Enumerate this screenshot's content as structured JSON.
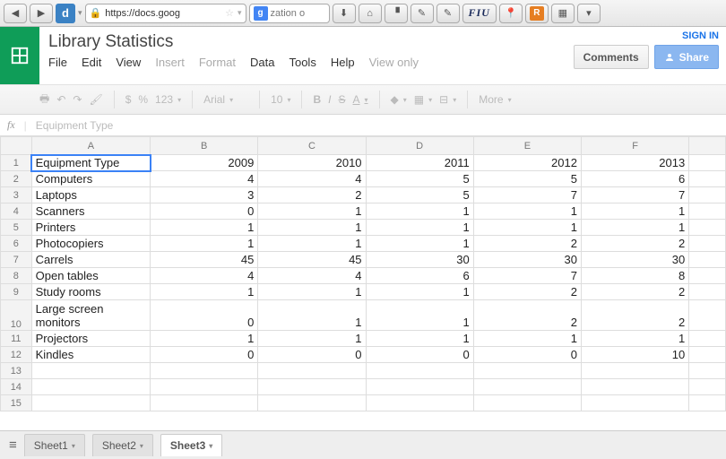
{
  "browser": {
    "url": "https://docs.goog",
    "search_text": "zation o"
  },
  "doc": {
    "title": "Library Statistics",
    "signin": "SIGN IN",
    "comments_label": "Comments",
    "share_label": "Share"
  },
  "menu": {
    "file": "File",
    "edit": "Edit",
    "view": "View",
    "insert": "Insert",
    "format": "Format",
    "data": "Data",
    "tools": "Tools",
    "help": "Help",
    "viewonly": "View only"
  },
  "toolbar": {
    "currency": "$",
    "percent": "%",
    "numfmt": "123",
    "font": "Arial",
    "size": "10",
    "bold": "B",
    "italic": "I",
    "strike": "S",
    "more": "More"
  },
  "fx": {
    "label": "fx",
    "value": "Equipment Type"
  },
  "columns": [
    "A",
    "B",
    "C",
    "D",
    "E",
    "F"
  ],
  "row_headers": [
    "1",
    "2",
    "3",
    "4",
    "5",
    "6",
    "7",
    "8",
    "9",
    "10",
    "11",
    "12",
    "13",
    "14",
    "15"
  ],
  "chart_data": {
    "type": "table",
    "title": "Library Statistics",
    "header_row": [
      "Equipment Type",
      "2009",
      "2010",
      "2011",
      "2012",
      "2013"
    ],
    "rows": [
      [
        "Computers",
        "4",
        "4",
        "5",
        "5",
        "6"
      ],
      [
        "Laptops",
        "3",
        "2",
        "5",
        "7",
        "7"
      ],
      [
        "Scanners",
        "0",
        "1",
        "1",
        "1",
        "1"
      ],
      [
        "Printers",
        "1",
        "1",
        "1",
        "1",
        "1"
      ],
      [
        "Photocopiers",
        "1",
        "1",
        "1",
        "2",
        "2"
      ],
      [
        "Carrels",
        "45",
        "45",
        "30",
        "30",
        "30"
      ],
      [
        "Open tables",
        "4",
        "4",
        "6",
        "7",
        "8"
      ],
      [
        "Study rooms",
        "1",
        "1",
        "1",
        "2",
        "2"
      ],
      [
        "Large screen monitors",
        "0",
        "1",
        "1",
        "2",
        "2"
      ],
      [
        "Projectors",
        "1",
        "1",
        "1",
        "1",
        "1"
      ],
      [
        "Kindles",
        "0",
        "0",
        "0",
        "0",
        "10"
      ]
    ]
  },
  "tabs": {
    "s1": "Sheet1",
    "s2": "Sheet2",
    "s3": "Sheet3"
  }
}
